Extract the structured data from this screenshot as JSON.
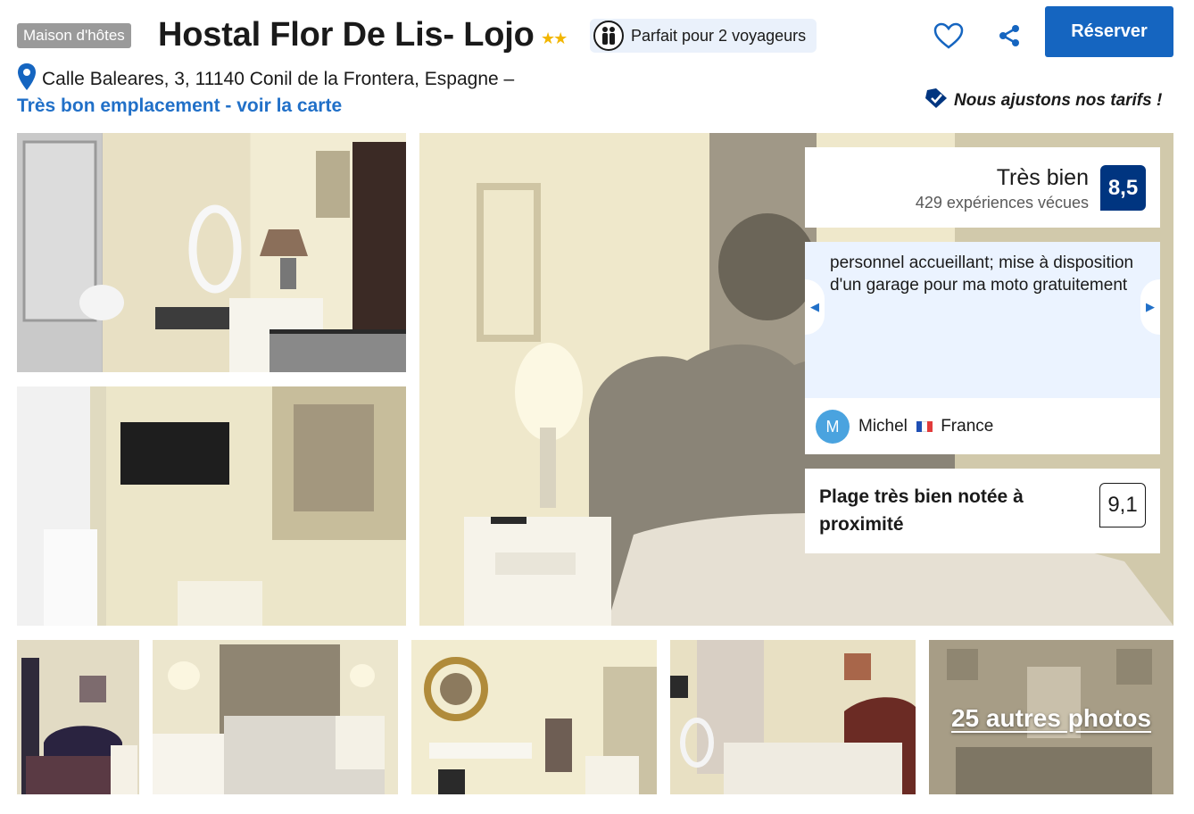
{
  "header": {
    "property_type": "Maison d'hôtes",
    "name": "Hostal Flor De Lis- Lojo",
    "stars": "★★",
    "travellers": "Parfait pour 2 voyageurs",
    "reserve_label": "Réserver"
  },
  "location": {
    "address": "Calle Baleares, 3, 11140 Conil de la Frontera, Espagne –",
    "location_link": "Très bon emplacement - voir la carte"
  },
  "price_note": "Nous ajustons nos tarifs !",
  "gallery": {
    "more_photos": "25 autres photos"
  },
  "rating": {
    "word": "Très bien",
    "count": "429 expériences vécues",
    "score": "8,5"
  },
  "review": {
    "quote": "personnel accueillant; mise à disposition d'un garage pour ma moto gratuitement",
    "avatar_initial": "M",
    "reviewer": "Michel",
    "country": "France"
  },
  "beach": {
    "text": "Plage très bien notée à proximité",
    "score": "9,1"
  },
  "colors": {
    "brand_blue": "#1565c0",
    "score_navy": "#003580",
    "link_blue": "#2170c8",
    "star_yellow": "#f2b600"
  }
}
